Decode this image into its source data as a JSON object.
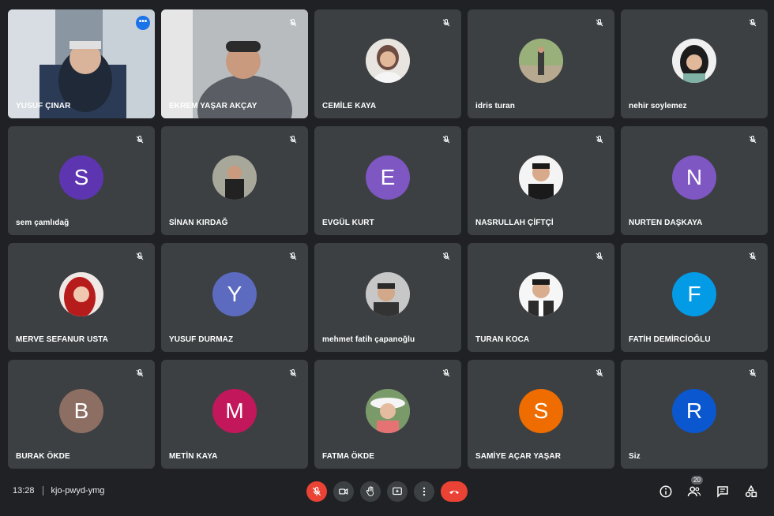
{
  "participants": [
    {
      "name": "YUSUF ÇINAR",
      "type": "video"
    },
    {
      "name": "EKREM YAŞAR AKÇAY",
      "type": "video"
    },
    {
      "name": "CEMİLE KAYA",
      "type": "photo"
    },
    {
      "name": "idris turan",
      "type": "photo"
    },
    {
      "name": "nehir soylemez",
      "type": "photo"
    },
    {
      "name": "sem çamlıdağ",
      "type": "initial",
      "initial": "S",
      "color": "#5e35b1"
    },
    {
      "name": "SİNAN KIRDAĞ",
      "type": "photo"
    },
    {
      "name": "EVGÜL KURT",
      "type": "initial",
      "initial": "E",
      "color": "#7e57c2"
    },
    {
      "name": "NASRULLAH ÇİFTÇİ",
      "type": "photo"
    },
    {
      "name": "NURTEN DAŞKAYA",
      "type": "initial",
      "initial": "N",
      "color": "#7e57c2"
    },
    {
      "name": "MERVE SEFANUR USTA",
      "type": "photo"
    },
    {
      "name": "YUSUF DURMAZ",
      "type": "initial",
      "initial": "Y",
      "color": "#5c6bc0"
    },
    {
      "name": "mehmet fatih çapanoğlu",
      "type": "photo"
    },
    {
      "name": "TURAN KOCA",
      "type": "photo"
    },
    {
      "name": "FATİH DEMİRCİOĞLU",
      "type": "initial",
      "initial": "F",
      "color": "#039be5"
    },
    {
      "name": "BURAK ÖKDE",
      "type": "initial",
      "initial": "B",
      "color": "#8d6e63"
    },
    {
      "name": "METİN KAYA",
      "type": "initial",
      "initial": "M",
      "color": "#c2185b"
    },
    {
      "name": "FATMA ÖKDE",
      "type": "photo"
    },
    {
      "name": "SAMİYE AÇAR YAŞAR",
      "type": "initial",
      "initial": "S",
      "color": "#ef6c00"
    },
    {
      "name": "Siz",
      "type": "initial",
      "initial": "R",
      "color": "#0b57d0"
    }
  ],
  "meeting": {
    "time": "13:28",
    "code": "kjo-pwyd-ymg"
  },
  "people_count": "20",
  "colors": {
    "background": "#202124",
    "tile": "#3c4043",
    "accent": "#8ab4f8",
    "end_call": "#ea4335"
  }
}
